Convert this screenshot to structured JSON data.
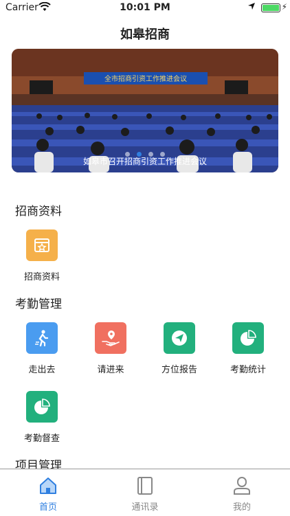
{
  "status_bar": {
    "carrier": "Carrier",
    "time": "10:01 PM"
  },
  "nav": {
    "title": "如皋招商"
  },
  "banner": {
    "caption": "如皋市召开招商引资工作推进会议",
    "slide_text": "全市招商引资工作推进会议",
    "dots_count": 4,
    "active_dot": 1
  },
  "sections": [
    {
      "title": "招商资料",
      "items": [
        {
          "label": "招商资料",
          "icon": "folder-star-icon",
          "color": "#f5b04a"
        }
      ]
    },
    {
      "title": "考勤管理",
      "items": [
        {
          "label": "走出去",
          "icon": "walking-person-icon",
          "color": "#4a9cf0"
        },
        {
          "label": "请进来",
          "icon": "location-hand-icon",
          "color": "#f07060"
        },
        {
          "label": "方位报告",
          "icon": "paper-plane-icon",
          "color": "#22b07d"
        },
        {
          "label": "考勤统计",
          "icon": "pie-chart-icon",
          "color": "#22b07d"
        },
        {
          "label": "考勤督查",
          "icon": "pie-chart-icon",
          "color": "#22b07d"
        }
      ]
    },
    {
      "title": "项目管理",
      "items": []
    }
  ],
  "tabbar": {
    "active_color": "#2f7fe0",
    "tabs": [
      {
        "label": "首页",
        "icon": "home-icon"
      },
      {
        "label": "通讯录",
        "icon": "contacts-icon"
      },
      {
        "label": "我的",
        "icon": "profile-icon"
      }
    ]
  }
}
